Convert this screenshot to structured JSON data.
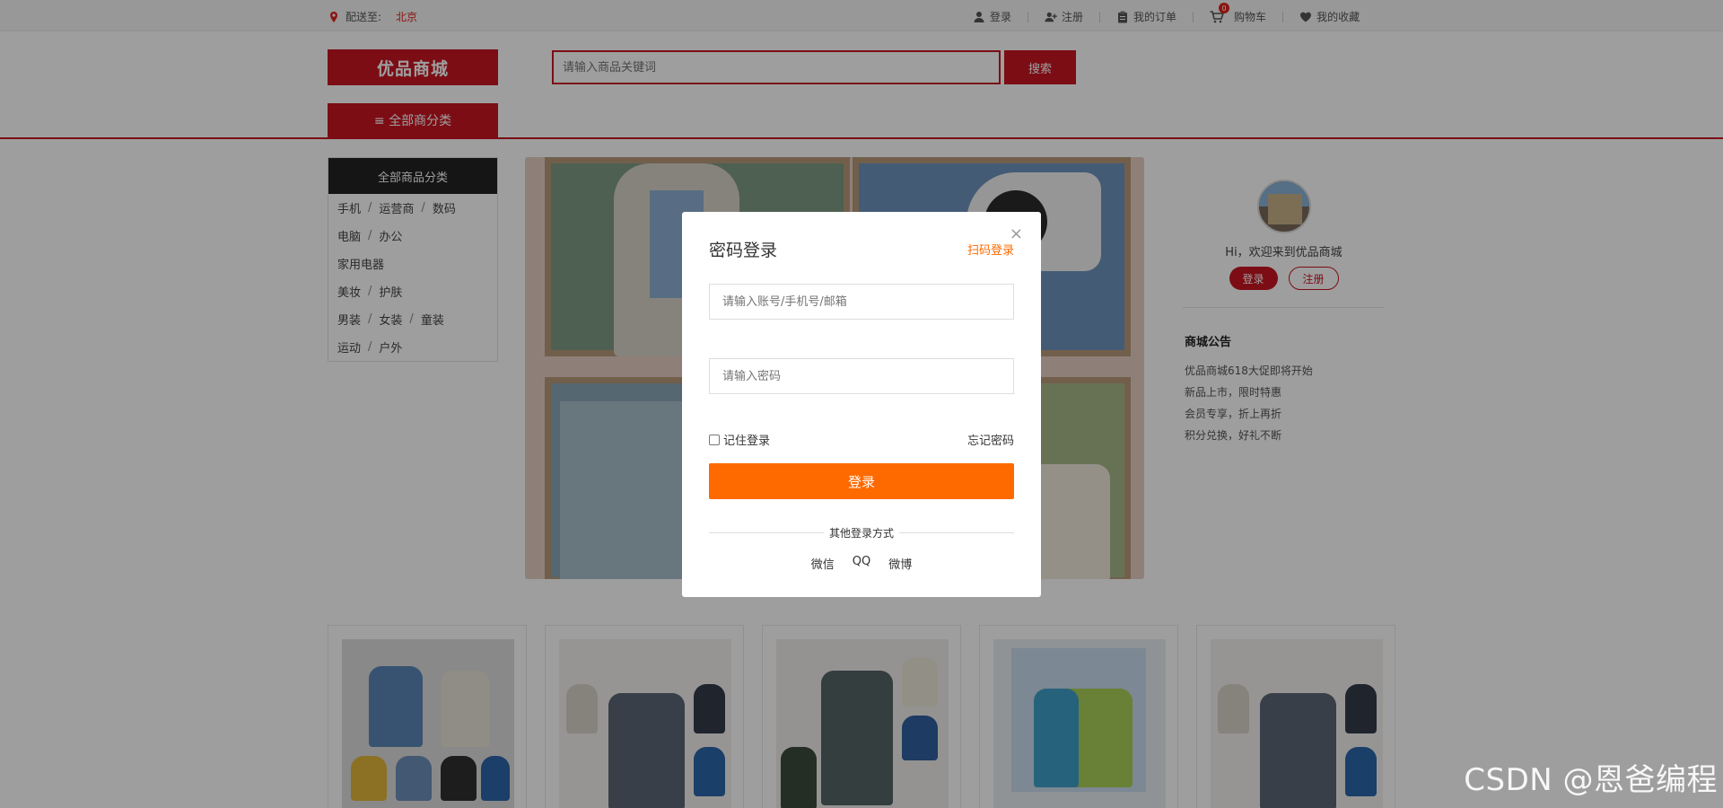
{
  "topbar": {
    "deliver_label": "配送至:",
    "city": "北京",
    "links": [
      {
        "label": "登录",
        "icon": "user-icon"
      },
      {
        "label": "注册",
        "icon": "user-plus-icon"
      },
      {
        "label": "我的订单",
        "icon": "clipboard-icon"
      },
      {
        "label": "购物车",
        "icon": "cart-icon",
        "badge": "0"
      },
      {
        "label": "我的收藏",
        "icon": "heart-icon"
      }
    ]
  },
  "header": {
    "logo": "优品商城",
    "search_placeholder": "请输入商品关键词",
    "search_button": "搜索",
    "all_categories_tab": "≡ 全部商分类"
  },
  "categories": {
    "title": "全部商品分类",
    "rows": [
      [
        "手机",
        "运营商",
        "数码"
      ],
      [
        "电脑",
        "办公"
      ],
      [
        "家用电器"
      ],
      [
        "美妆",
        "护肤"
      ],
      [
        "男装",
        "女装",
        "童装"
      ],
      [
        "运动",
        "户外"
      ]
    ]
  },
  "welcome": {
    "greeting": "Hi，欢迎来到优品商城",
    "login": "登录",
    "register": "注册"
  },
  "notice": {
    "title": "商城公告",
    "items": [
      "优品商城618大促即将开始",
      "新品上市，限时特惠",
      "会员专享，折上再折",
      "积分兑换，好礼不断"
    ]
  },
  "modal": {
    "title": "密码登录",
    "qr_login": "扫码登录",
    "close": "×",
    "account_placeholder": "请输入账号/手机号/邮箱",
    "password_placeholder": "请输入密码",
    "remember": "记住登录",
    "forgot": "忘记密码",
    "login_button": "登录",
    "other_methods": "其他登录方式",
    "methods": [
      "微信",
      "QQ",
      "微博"
    ]
  },
  "watermark": "CSDN @恩爸编程",
  "colors": {
    "brand_red": "#c81623",
    "login_orange": "#ff6a00"
  }
}
